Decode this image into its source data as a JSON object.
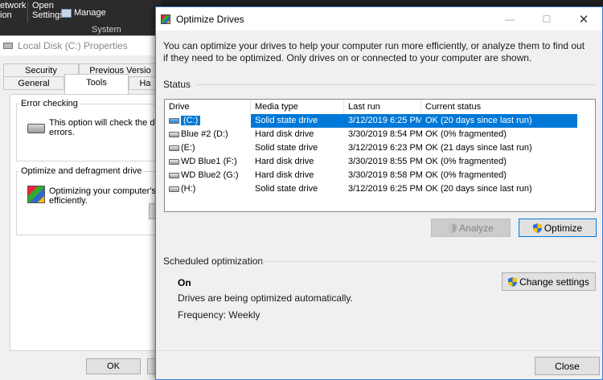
{
  "background": {
    "ribbon": {
      "network_line1": "etwork",
      "network_line2": "ion",
      "open_line1": "Open",
      "open_line2": "Settings",
      "manage_label": "Manage",
      "group_label": "System"
    },
    "properties": {
      "title": "Local Disk (C:) Properties",
      "tabs_top": [
        "Security",
        "Previous Versio"
      ],
      "tabs_bottom": [
        "General",
        "Tools",
        "Ha"
      ],
      "error_group_title": "Error checking",
      "error_text_line1": "This option will check the drive fo",
      "error_text_line2": "errors.",
      "defrag_group_title": "Optimize and defragment drive",
      "defrag_text_line1": "Optimizing your computer's drive",
      "defrag_text_line2": "efficiently.",
      "ok_label": "OK"
    }
  },
  "window": {
    "title": "Optimize Drives",
    "controls": {
      "minimize": "—",
      "maximize": "☐",
      "close": "✕"
    },
    "intro": "You can optimize your drives to help your computer run more efficiently, or analyze them to find out if they need to be optimized. Only drives on or connected to your computer are shown.",
    "status_label": "Status",
    "columns": [
      "Drive",
      "Media type",
      "Last run",
      "Current status"
    ],
    "drives": [
      {
        "drive": "(C:)",
        "media": "Solid state drive",
        "last_run": "3/12/2019 6:25 PM",
        "status": "OK (20 days since last run)",
        "icon": "windows-drive-icon"
      },
      {
        "drive": "Blue #2 (D:)",
        "media": "Hard disk drive",
        "last_run": "3/30/2019 8:54 PM",
        "status": "OK (0% fragmented)",
        "icon": "drive-icon"
      },
      {
        "drive": "(E:)",
        "media": "Solid state drive",
        "last_run": "3/12/2019 6:23 PM",
        "status": "OK (21 days since last run)",
        "icon": "drive-icon"
      },
      {
        "drive": "WD Blue1 (F:)",
        "media": "Hard disk drive",
        "last_run": "3/30/2019 8:55 PM",
        "status": "OK (0% fragmented)",
        "icon": "drive-icon"
      },
      {
        "drive": "WD Blue2 (G:)",
        "media": "Hard disk drive",
        "last_run": "3/30/2019 8:58 PM",
        "status": "OK (0% fragmented)",
        "icon": "drive-icon"
      },
      {
        "drive": "(H:)",
        "media": "Solid state drive",
        "last_run": "3/12/2019 6:25 PM",
        "status": "OK (20 days since last run)",
        "icon": "drive-icon"
      }
    ],
    "selected_row": 0,
    "analyze_label": "Analyze",
    "optimize_label": "Optimize",
    "scheduled_label": "Scheduled optimization",
    "schedule_state": "On",
    "schedule_desc": "Drives are being optimized automatically.",
    "frequency": "Frequency: Weekly",
    "change_settings_label": "Change settings",
    "close_label": "Close",
    "colors": {
      "selection": "#0078d7",
      "accent_border": "#3a7bd5"
    }
  }
}
